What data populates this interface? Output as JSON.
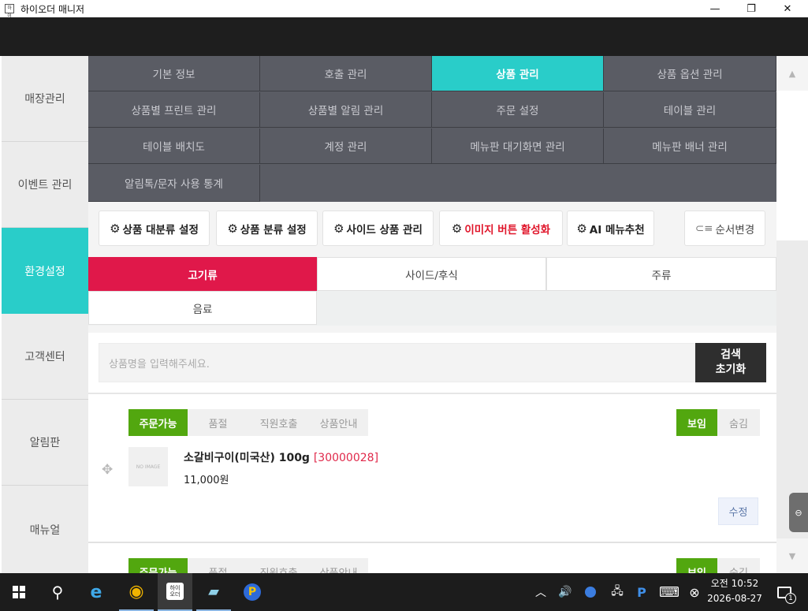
{
  "window": {
    "app_icon_text": "하이",
    "title": "하이오더 매니저",
    "minimize": "—",
    "maximize": "❐",
    "close": "✕"
  },
  "sidebar": {
    "items": [
      {
        "label": "매장관리"
      },
      {
        "label": "이벤트 관리"
      },
      {
        "label": "환경설정"
      },
      {
        "label": "고객센터"
      },
      {
        "label": "알림판"
      },
      {
        "label": "매뉴얼"
      }
    ],
    "active": "환경설정"
  },
  "topmenu": {
    "items": [
      {
        "label": "기본 정보"
      },
      {
        "label": "호출 관리"
      },
      {
        "label": "상품 관리"
      },
      {
        "label": "상품 옵션 관리"
      },
      {
        "label": "상품별 프린트 관리"
      },
      {
        "label": "상품별 알림 관리"
      },
      {
        "label": "주문 설정"
      },
      {
        "label": "테이블 관리"
      },
      {
        "label": "테이블 배치도"
      },
      {
        "label": "계정 관리"
      },
      {
        "label": "메뉴판 대기화면 관리"
      },
      {
        "label": "메뉴판 배너 관리"
      },
      {
        "label": "알림톡/문자 사용 통계"
      }
    ],
    "active": "상품 관리"
  },
  "toolbar": {
    "gear_glyph": "⚙",
    "major_category": "상품 대분류 설정",
    "category": "상품 분류 설정",
    "side_products": "사이드 상품 관리",
    "image_button": "이미지 버튼 활성화",
    "ai_recommend": "AI 메뉴추천",
    "reorder_glyph": "⊂≡",
    "reorder": "순서변경"
  },
  "category_tabs": [
    {
      "label": "고기류"
    },
    {
      "label": "사이드/후식"
    },
    {
      "label": "주류"
    },
    {
      "label": "음료"
    }
  ],
  "active_category": "고기류",
  "search": {
    "placeholder": "상품명을 입력해주세요.",
    "search_label": "검색",
    "reset_label": "초기화"
  },
  "product_card": {
    "status_options": [
      "주문가능",
      "품절",
      "직원호출",
      "상품안내"
    ],
    "status_selected": "주문가능",
    "visibility_options": [
      "보임",
      "숨김"
    ],
    "visibility_selected": "보임",
    "move_glyph": "✥",
    "thumbnail_text": "NO IMAGE",
    "name": "소갈비구이(미국산) 100g",
    "code": "[30000028]",
    "price": "11,000원",
    "edit_label": "수정"
  },
  "scrollbar": {
    "up_glyph": "▲",
    "down_glyph": "▼",
    "handle_glyph": "⊖"
  },
  "taskbar": {
    "search_glyph": "⚲",
    "edge_glyph": "e",
    "chrome_glyph": "◉",
    "hiorder_text": "하이\n오더",
    "notes_glyph": "▰",
    "p_app_glyph": "P",
    "tray_chevron": "︿",
    "volume_glyph": "🔊",
    "network_glyph": "🖧",
    "p_tray": "P",
    "keyboard_glyph": "⌨",
    "close_tray_glyph": "⊗",
    "time": "오전 10:52",
    "date": "2026-08-27",
    "notification_count": "1"
  }
}
